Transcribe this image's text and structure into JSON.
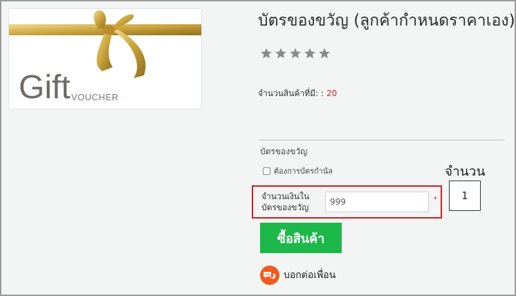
{
  "product": {
    "title": "บัตรของขวัญ (ลูกค้ากำหนดราคาเอง)",
    "image": {
      "gift_text": "Gift",
      "voucher_text": "VOUCHER"
    },
    "rating_stars": 5,
    "stock_label": "จำนวนสินค้าที่มี: :",
    "stock_value": "20"
  },
  "gift_card": {
    "section_label": "บัตรของขวัญ",
    "checkbox_label": "ต้องการบัตรกำนัล",
    "amount_label": "จำนวนเงินในบัตรของขวัญ",
    "amount_value": "999",
    "required_mark": "*"
  },
  "quantity": {
    "label": "จำนวน",
    "value": "1"
  },
  "actions": {
    "buy_label": "ซื้อสินค้า",
    "share_label": "บอกต่อเพื่อน"
  },
  "colors": {
    "star": "#8a8a8a",
    "stock_value": "#e0201a",
    "highlight_border": "#d21d1d",
    "buy_button": "#1db84a",
    "share_icon": "#f25a1b",
    "ribbon_gold": "#c9a33a"
  },
  "icons": [
    "star-icon",
    "checkbox",
    "chat-bubbles-icon"
  ]
}
